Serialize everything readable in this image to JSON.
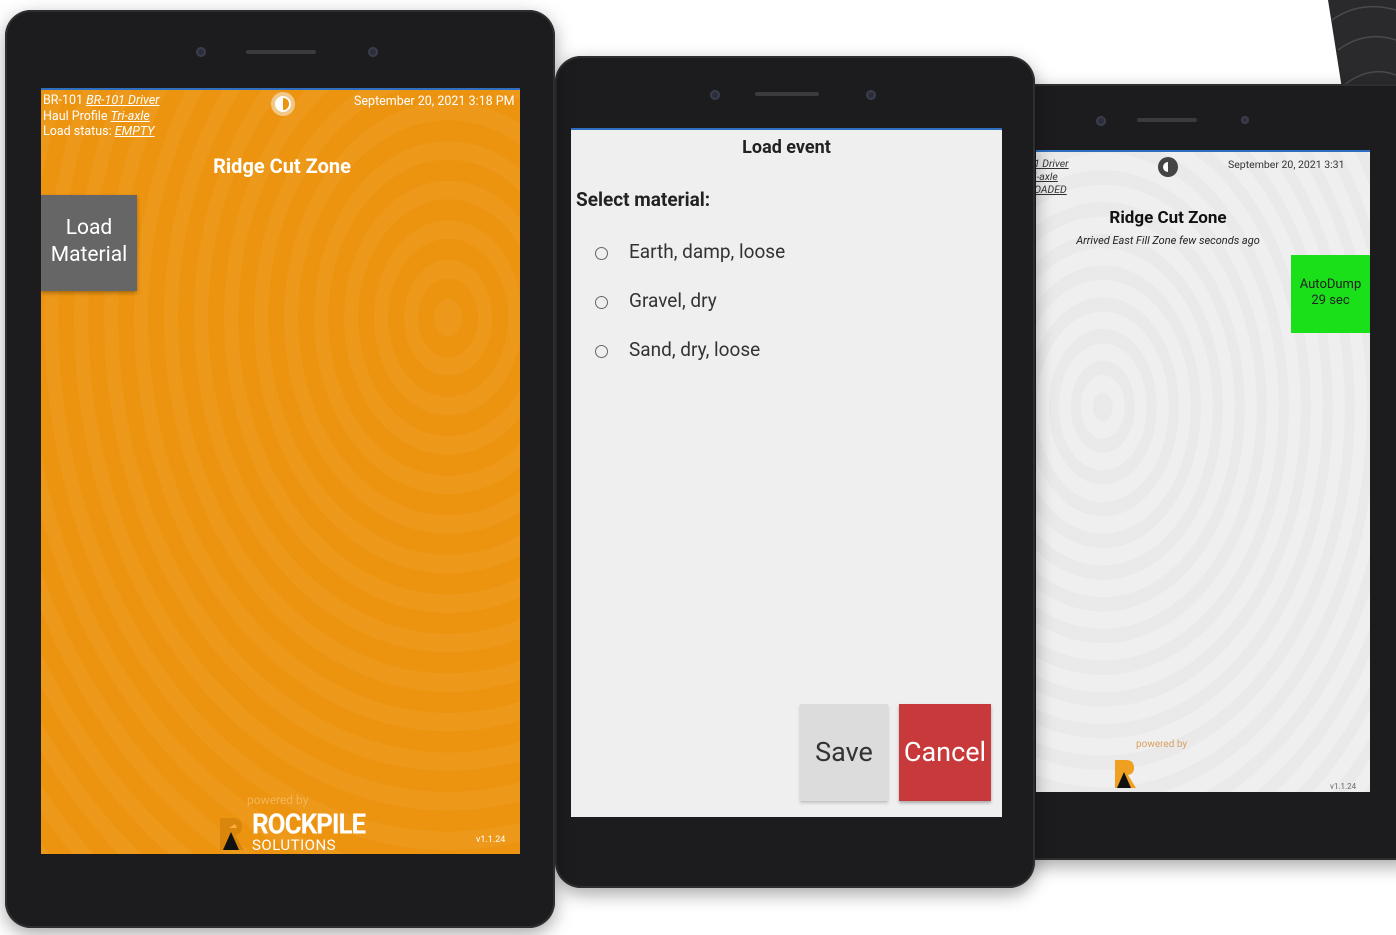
{
  "tablet1": {
    "header": {
      "truck_id": "BR-101",
      "driver": "BR-101 Driver",
      "haul_profile_label": "Haul Profile",
      "haul_profile": "Tri-axle",
      "load_status_label": "Load status:",
      "load_status": "EMPTY",
      "datetime": "September 20, 2021 3:18 PM"
    },
    "zone_title": "Ridge Cut Zone",
    "load_button_line1": "Load",
    "load_button_line2": "Material",
    "powered_by": "powered by",
    "brand_name": "ROCKPILE",
    "brand_sub": "SOLUTIONS",
    "version": "v1.1.24",
    "colors": {
      "background": "#ec9410",
      "button": "#666666"
    }
  },
  "tablet2": {
    "dialog_title": "Load event",
    "prompt": "Select material:",
    "options": [
      "Earth, damp, loose",
      "Gravel, dry",
      "Sand, dry, loose"
    ],
    "save_label": "Save",
    "cancel_label": "Cancel",
    "colors": {
      "cancel": "#c8393b",
      "save": "#dcdcdc"
    }
  },
  "tablet3": {
    "header": {
      "driver": "1 Driver",
      "haul_profile": "i-axle",
      "load_status": "OADED",
      "datetime": "September 20, 2021 3:31"
    },
    "zone_title": "Ridge Cut Zone",
    "arrival_text": "Arrived East Fill Zone few seconds ago",
    "autodump_label": "AutoDump",
    "autodump_timer": "29 sec",
    "powered_by": "powered by",
    "version": "v1.1.24",
    "colors": {
      "autodump": "#19e019"
    }
  }
}
